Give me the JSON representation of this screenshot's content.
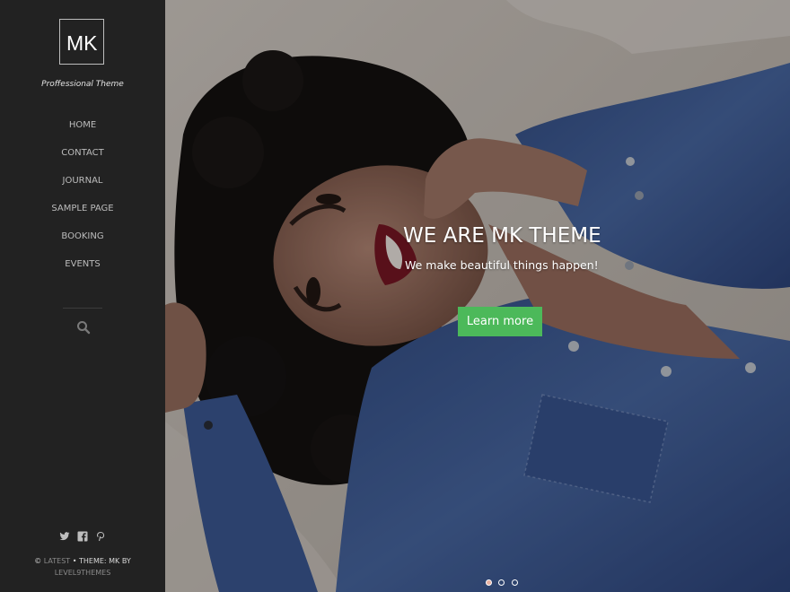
{
  "sidebar": {
    "logo": "MK",
    "tagline": "Proffessional Theme",
    "nav": [
      "HOME",
      "CONTACT",
      "JOURNAL",
      "SAMPLE PAGE",
      "BOOKING",
      "EVENTS"
    ],
    "search_icon": "search-icon",
    "social_icons": [
      "twitter-icon",
      "facebook-icon",
      "pinterest-icon"
    ],
    "footer": {
      "copyright": "©",
      "site_link": "LATEST",
      "text": "• THEME: MK BY",
      "author_link": "LEVEL9THEMES"
    }
  },
  "hero": {
    "title": "WE ARE MK THEME",
    "subtitle": "We make beautiful things happen!",
    "button_label": "Learn more",
    "slide_count": 3,
    "active_slide": 1
  },
  "colors": {
    "sidebar_bg": "#222222",
    "accent": "#4cb95a",
    "text_light": "#ffffff"
  }
}
